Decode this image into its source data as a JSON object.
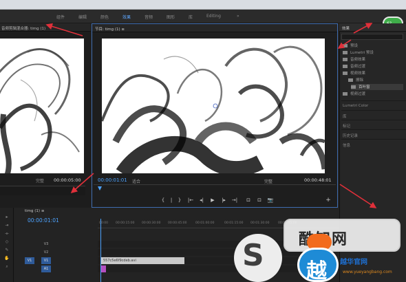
{
  "menubar": {
    "workspaces": [
      "组件",
      "编辑",
      "颜色",
      "效果",
      "音频",
      "图形",
      "库",
      "Editing",
      "»"
    ],
    "active_workspace": "效果"
  },
  "corner_badge": "6?",
  "source_monitor": {
    "tab_title": "音频剪辑混合器: timg (1)",
    "fit_label": "完整",
    "timecode_out": "00:00:05:00"
  },
  "program_monitor": {
    "tab_title": "节目: timg (1)  ≡",
    "timecode_in": "00:00:01:01",
    "fit_label": "适合",
    "quality_label": "完整",
    "timecode_out": "00:00:48:01",
    "controls": [
      "{",
      "|",
      "}",
      "|←",
      "◂|",
      "▶",
      "|▸",
      "→|",
      "⊡",
      "⊡",
      "📷"
    ]
  },
  "effects_panel": {
    "tab_title": "效果",
    "panel_label": "效果",
    "tree": [
      "预设",
      "Lumetri 预设",
      "音频效果",
      "音频过渡",
      "视频效果",
      "擦除",
      "百叶窗",
      "视频过渡"
    ],
    "tree_selected": "百叶窗",
    "sections": [
      "Lumetri Color",
      "库",
      "标记",
      "历史记录",
      "信息"
    ]
  },
  "timeline": {
    "tab_title": "timg (1)  ≡",
    "timecode": "00:00:01:01",
    "ruler_ticks": [
      "00:00",
      "00:00:15:00",
      "00:00:30:00",
      "00:00:45:00",
      "00:01:00:00",
      "00:01:15:00",
      "00:01:30:00",
      "00:01:45:00"
    ],
    "video_tracks": [
      "V3",
      "V2",
      "V1"
    ],
    "audio_tracks": [
      "A1"
    ],
    "clip_name": "557c5e6f9cdeb.avi"
  },
  "watermark": {
    "mid_text": "酷知网",
    "site_cn": "越华官网",
    "site_url": "www.yueyangbang.com",
    "glyph": "S",
    "logo_glyph": "越"
  },
  "colors": {
    "accent": "#4da3ff",
    "panel_bg": "#232323",
    "arrow_red": "#e0303a",
    "clip_audio": "#b54fc0"
  }
}
